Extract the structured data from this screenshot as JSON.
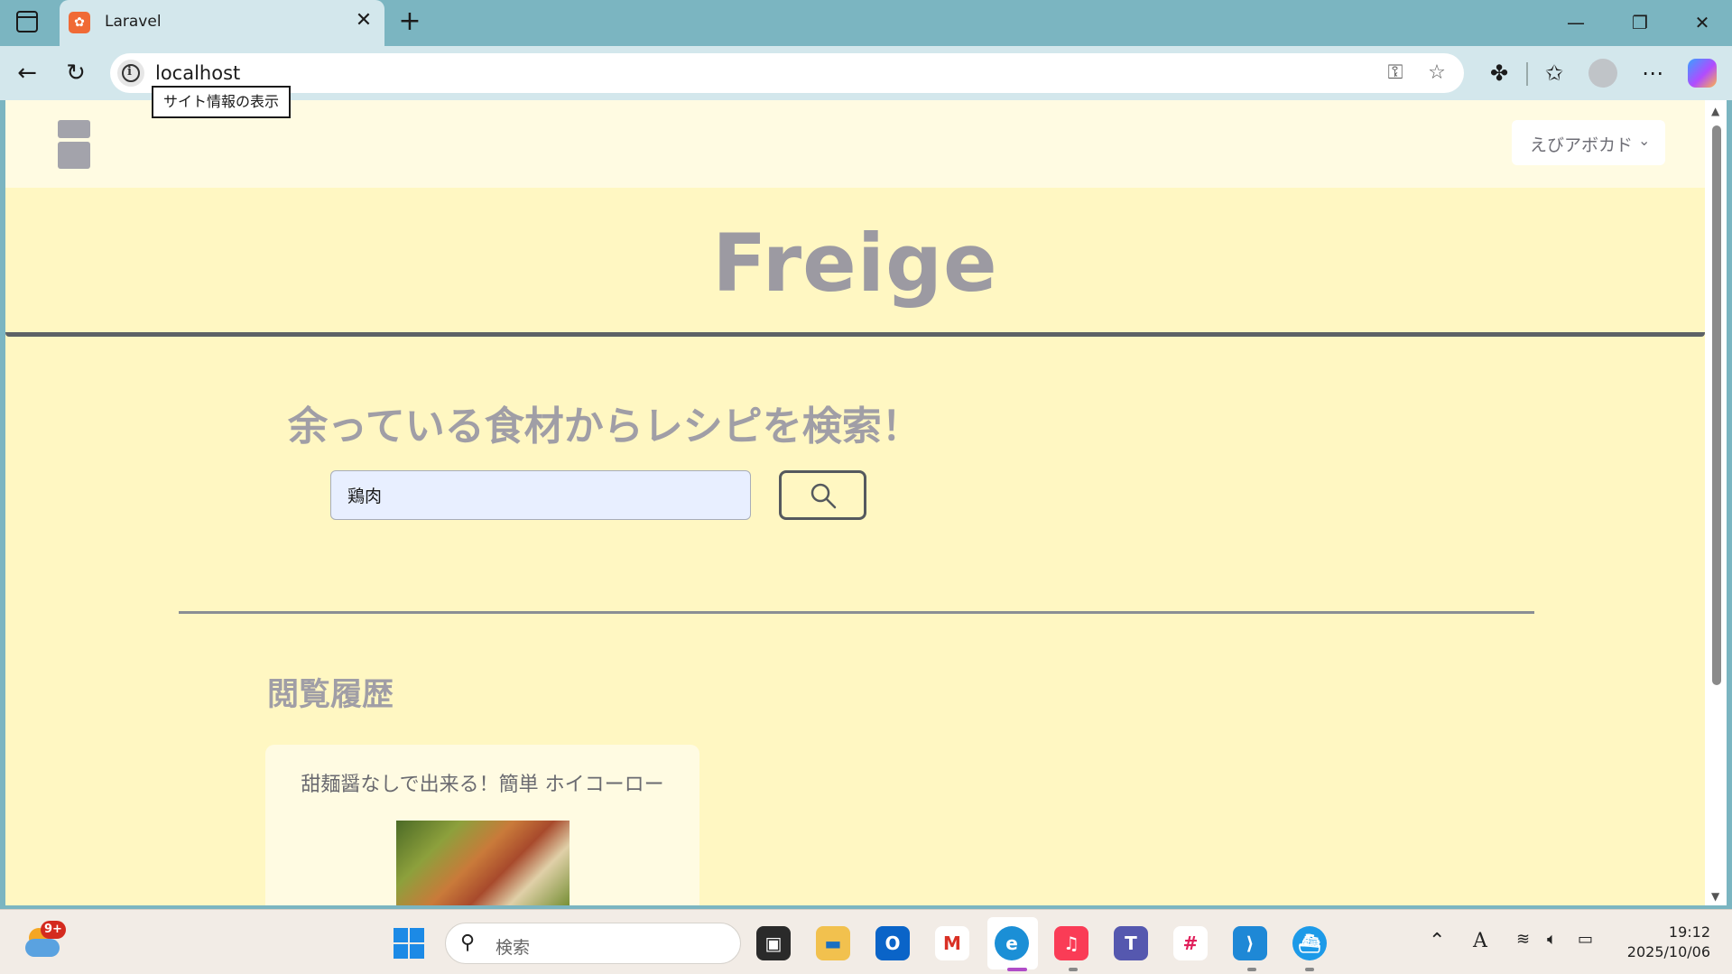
{
  "browser": {
    "tab": {
      "title": "Laravel"
    },
    "address": {
      "url": "localhost",
      "tooltip": "サイト情報の表示"
    }
  },
  "app": {
    "brand": "Freige",
    "user_menu": {
      "name": "えびアボカド"
    },
    "search": {
      "heading": "余っている食材からレシピを検索！",
      "value": "鶏肉"
    },
    "history": {
      "heading": "閲覧履歴",
      "items": [
        {
          "title": "甜麺醤なしで出来る！簡単 ホイコーロー"
        }
      ]
    }
  },
  "taskbar": {
    "weather_badge": "9+",
    "search_placeholder": "検索",
    "tray_ime": "A",
    "clock": {
      "time": "19:12",
      "date": "2025/10/06"
    }
  },
  "colors": {
    "page_background": "#fff7c2",
    "header_background": "#fffbe2",
    "heading_text": "#a09ea6",
    "search_input_background": "#e8efff",
    "browser_frame": "#7bb5c1"
  }
}
